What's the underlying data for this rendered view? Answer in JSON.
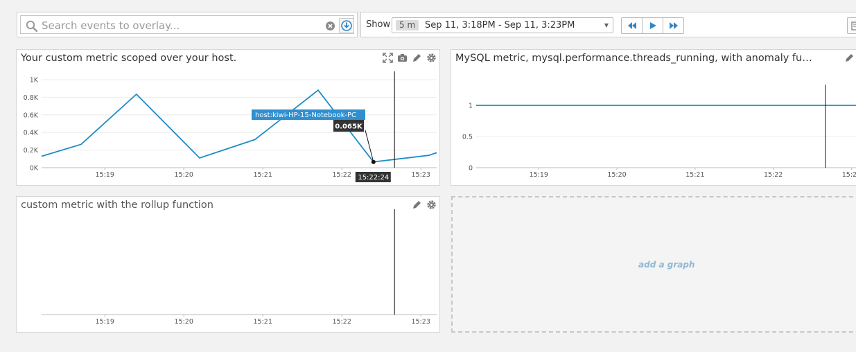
{
  "search": {
    "placeholder": "Search events to overlay..."
  },
  "timeframe": {
    "show_label": "Show",
    "span": "5 m",
    "range": "Sep 11, 3:18PM - Sep 11, 3:23PM"
  },
  "icons": {
    "search": "search-icon",
    "clear": "clear-icon",
    "overlay": "overlay-download-icon",
    "rewind": "rewind-icon",
    "play": "play-icon",
    "forward": "fast-forward-icon",
    "expand": "expand-icon",
    "snapshot": "camera-icon",
    "edit": "pencil-icon",
    "settings": "gear-icon"
  },
  "colors": {
    "series": "#1d8dc9",
    "accent": "#2e86c9",
    "tooltip_host_bg": "#2f8fcf",
    "tooltip_value_bg": "#333333"
  },
  "widgets": [
    {
      "title": "Your custom metric scoped over your host.",
      "tooltip_host": "host:kiwi-HP-15-Notebook-PC",
      "tooltip_value": "0.065K",
      "tooltip_time": "15:22:24"
    },
    {
      "title": "MySQL metric, mysql.performance.threads_running, with anomaly funct..."
    },
    {
      "title": "custom metric with the rollup function"
    }
  ],
  "add_graph_label": "add a graph",
  "chart_data": [
    {
      "type": "line",
      "title": "Your custom metric scoped over your host.",
      "x_ticks": [
        "15:19",
        "15:20",
        "15:21",
        "15:22",
        "15:23"
      ],
      "y_ticks": [
        "0K",
        "0.2K",
        "0.4K",
        "0.6K",
        "0.8K",
        "1K"
      ],
      "ylim": [
        0,
        1000
      ],
      "xlim": [
        "15:18:12",
        "15:23:12"
      ],
      "series": [
        {
          "x": [
            "15:18:12",
            "15:18:42",
            "15:19:24",
            "15:20:12",
            "15:20:54",
            "15:21:42",
            "15:22:24",
            "15:23:06",
            "15:23:12"
          ],
          "values": [
            130,
            265,
            835,
            110,
            320,
            880,
            65,
            140,
            170
          ]
        }
      ],
      "marker": {
        "x": "15:22:40"
      },
      "grid": true
    },
    {
      "type": "line",
      "title": "MySQL metric, mysql.performance.threads_running, with anomaly funct...",
      "x_ticks": [
        "15:19",
        "15:20",
        "15:21",
        "15:22",
        "15:23"
      ],
      "y_ticks": [
        "0",
        "0.5",
        "1"
      ],
      "ylim": [
        0,
        1.2
      ],
      "xlim": [
        "15:18:12",
        "15:23:12"
      ],
      "series": [
        {
          "x": [
            "15:18:12",
            "15:23:12"
          ],
          "values": [
            1,
            1
          ]
        }
      ],
      "marker": {
        "x": "15:22:40"
      },
      "grid": true
    },
    {
      "type": "line",
      "title": "custom metric with the rollup function",
      "x_ticks": [
        "15:19",
        "15:20",
        "15:21",
        "15:22",
        "15:23"
      ],
      "y_ticks": [],
      "xlim": [
        "15:18:12",
        "15:23:12"
      ],
      "series": [],
      "marker": {
        "x": "15:22:40"
      },
      "grid": false
    }
  ]
}
